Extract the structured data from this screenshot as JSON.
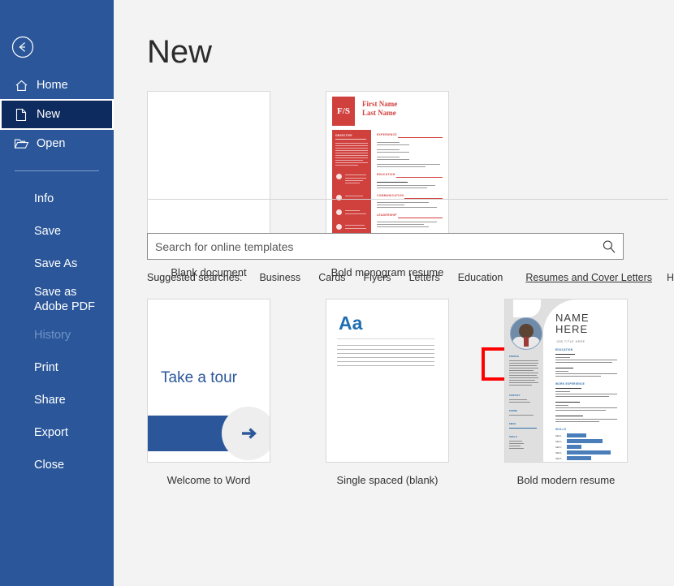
{
  "sidebar": {
    "back_icon": "back-arrow-circle-icon",
    "primary": [
      {
        "label": "Home",
        "icon": "home-icon",
        "selected": false
      },
      {
        "label": "New",
        "icon": "new-document-icon",
        "selected": true
      },
      {
        "label": "Open",
        "icon": "open-folder-icon",
        "selected": false
      }
    ],
    "secondary": [
      {
        "label": "Info",
        "disabled": false
      },
      {
        "label": "Save",
        "disabled": false
      },
      {
        "label": "Save As",
        "disabled": false
      },
      {
        "label": "Save as Adobe PDF",
        "disabled": false
      },
      {
        "label": "History",
        "disabled": true
      },
      {
        "label": "Print",
        "disabled": false
      },
      {
        "label": "Share",
        "disabled": false
      },
      {
        "label": "Export",
        "disabled": false
      },
      {
        "label": "Close",
        "disabled": false
      }
    ]
  },
  "main": {
    "title": "New",
    "featured_templates": [
      {
        "caption": "Blank document",
        "art": "blank"
      },
      {
        "caption": "Bold monogram resume",
        "art": "bold-monogram-resume"
      }
    ],
    "search": {
      "placeholder": "Search for online templates",
      "value": "",
      "icon": "search-icon"
    },
    "suggested": {
      "label": "Suggested searches:",
      "items": [
        {
          "label": "Business",
          "highlighted": false
        },
        {
          "label": "Cards",
          "highlighted": false
        },
        {
          "label": "Flyers",
          "highlighted": false
        },
        {
          "label": "Letters",
          "highlighted": false
        },
        {
          "label": "Education",
          "highlighted": false
        },
        {
          "label": "Resumes and Cover Letters",
          "highlighted": true
        },
        {
          "label": "Holiday",
          "highlighted": false
        }
      ]
    },
    "templates": [
      {
        "caption": "Welcome to Word",
        "art": "take-a-tour",
        "tour_text": "Take a tour"
      },
      {
        "caption": "Single spaced (blank)",
        "art": "single-spaced",
        "sample_text": "Aa"
      },
      {
        "caption": "Bold modern resume",
        "art": "bold-modern-resume",
        "name_line1": "NAME",
        "name_line2": "HERE",
        "job_title": "JOB TITLE HERE"
      }
    ]
  },
  "annotation": {
    "type": "red-highlight-box",
    "target": "Resumes and Cover Letters",
    "color": "#ff0000"
  },
  "colors": {
    "sidebar_bg": "#2b579a",
    "sidebar_selected_bg": "#0d2b5e",
    "page_bg": "#f3f3f3",
    "accent_red": "#d0413e",
    "accent_blue": "#2b579a"
  }
}
